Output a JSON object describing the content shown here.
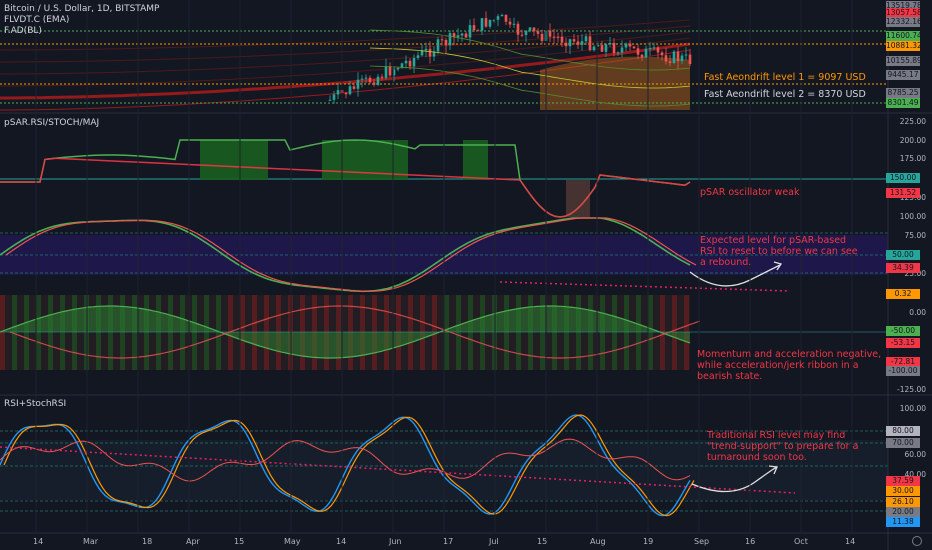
{
  "panes": {
    "main": {
      "title": "Bitcoin / U.S. Dollar, 1D, BITSTAMP",
      "indicators": [
        "FLVDT.C (EMA)",
        "F.AD(BL)"
      ],
      "notes": [
        "Fast Aeondrift level 1 = 9097 USD",
        "Fast Aeondrift level 2 = 8370 USD"
      ],
      "price_tags": [
        {
          "text": "13519.78",
          "color": "#787b86"
        },
        {
          "text": "13057.58",
          "color": "#f23645"
        },
        {
          "text": "12332.16",
          "color": "#787b86"
        },
        {
          "text": "11600.74",
          "color": "#4caf50"
        },
        {
          "text": "10881.32",
          "color": "#ff9800"
        },
        {
          "text": "10155.89",
          "color": "#787b86"
        },
        {
          "text": "9445.17",
          "color": "#787b86"
        },
        {
          "text": "8785.25",
          "color": "#787b86"
        },
        {
          "text": "8301.49",
          "color": "#4caf50"
        }
      ]
    },
    "psar": {
      "title": "pSAR.RSI/STOCH/MAJ",
      "axis": [
        "225.00",
        "200.00",
        "175.00",
        "125.00",
        "100.00",
        "75.00",
        "25.00",
        "0.00",
        "-125.00"
      ],
      "tags": [
        {
          "text": "150.00",
          "color": "#26a69a"
        },
        {
          "text": "131.52",
          "color": "#f23645"
        },
        {
          "text": "50.00",
          "color": "#26a69a"
        },
        {
          "text": "34.39",
          "color": "#f23645"
        },
        {
          "text": "0.32",
          "color": "#ff9800"
        },
        {
          "text": "-50.00",
          "color": "#4caf50"
        },
        {
          "text": "-53.15",
          "color": "#f23645"
        },
        {
          "text": "-72.81",
          "color": "#f23645"
        },
        {
          "text": "-100.00",
          "color": "#787b86"
        }
      ],
      "notes": [
        "pSAR oscillator weak",
        "Expected level for pSAR-based\nRSI to reset to before we can see\na rebound.",
        "Momentum and acceleration negative,\nwhile acceleration/jerk ribbon in a\nbearish state."
      ]
    },
    "rsi": {
      "title": "RSI+StochRSI",
      "axis": [
        "100.00",
        "60.00",
        "40.00"
      ],
      "tags": [
        {
          "text": "80.00",
          "color": "#b2b5be"
        },
        {
          "text": "70.00",
          "color": "#787b86"
        },
        {
          "text": "37.59",
          "color": "#f23645"
        },
        {
          "text": "30.00",
          "color": "#ff9800"
        },
        {
          "text": "26.10",
          "color": "#ff9800"
        },
        {
          "text": "20.00",
          "color": "#787b86"
        },
        {
          "text": "11.38",
          "color": "#2196f3"
        }
      ],
      "note": "Traditional RSI level may find\n\"trend-support\" to prepare for a\nturnaround soon too."
    }
  },
  "time_axis": [
    "14",
    "Mar",
    "18",
    "Apr",
    "15",
    "May",
    "14",
    "Jun",
    "17",
    "Jul",
    "15",
    "Aug",
    "19",
    "Sep",
    "16",
    "Oct",
    "14"
  ],
  "colors": {
    "background": "#131722",
    "up": "#26a69a",
    "down": "#ef5350",
    "psar_green": "#4caf50",
    "psar_red": "#f23645",
    "note_orange": "#ff9800",
    "note_red": "#f23645"
  }
}
